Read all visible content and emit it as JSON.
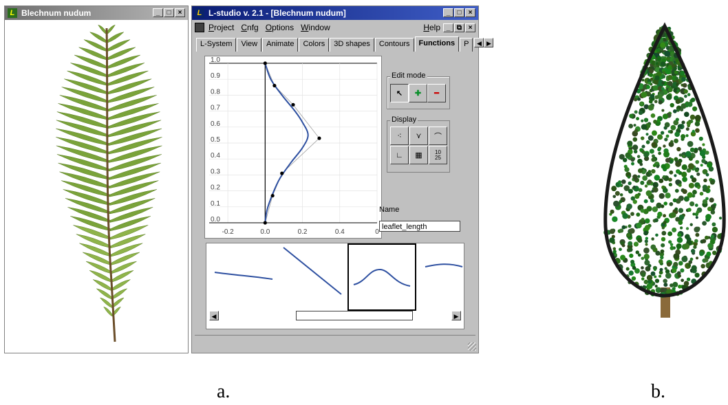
{
  "left_window": {
    "title": "Blechnum nudum",
    "icon": "L",
    "buttons": [
      "_",
      "□",
      "×"
    ]
  },
  "main_window": {
    "title": "L-studio v. 2.1 - [Blechnum nudum]",
    "icon": "L",
    "buttons": [
      "_",
      "□",
      "×"
    ],
    "menu": [
      "Project",
      "Cnfg",
      "Options",
      "Window"
    ],
    "help_label": "Help",
    "mdi_buttons": [
      "_",
      "⧉",
      "×"
    ],
    "tabs": [
      "L-System",
      "View",
      "Animate",
      "Colors",
      "3D shapes",
      "Contours",
      "Functions",
      "P"
    ],
    "active_tab": "Functions",
    "edit_mode_label": "Edit mode",
    "display_label": "Display",
    "name_label": "Name",
    "name_value": "leaflet_length"
  },
  "chart_data": {
    "type": "line",
    "title": "",
    "xlabel": "",
    "ylabel": "",
    "xlim": [
      -0.3,
      0.6
    ],
    "ylim": [
      0.0,
      1.0
    ],
    "y_ticks": [
      "1.0",
      "0.9",
      "0.8",
      "0.7",
      "0.6",
      "0.5",
      "0.4",
      "0.3",
      "0.2",
      "0.1",
      "0.0"
    ],
    "x_ticks": [
      "-0.2",
      "0.0",
      "0.2",
      "0.4",
      "0"
    ],
    "control_points": [
      {
        "x": 0.0,
        "y": 1.0
      },
      {
        "x": 0.05,
        "y": 0.86
      },
      {
        "x": 0.15,
        "y": 0.74
      },
      {
        "x": 0.29,
        "y": 0.53
      },
      {
        "x": 0.09,
        "y": 0.31
      },
      {
        "x": 0.04,
        "y": 0.17
      },
      {
        "x": 0.0,
        "y": 0.0
      }
    ],
    "curve": [
      {
        "x": 0.0,
        "y": 1.0
      },
      {
        "x": 0.03,
        "y": 0.9
      },
      {
        "x": 0.09,
        "y": 0.8
      },
      {
        "x": 0.16,
        "y": 0.7
      },
      {
        "x": 0.2,
        "y": 0.63
      },
      {
        "x": 0.23,
        "y": 0.55
      },
      {
        "x": 0.2,
        "y": 0.47
      },
      {
        "x": 0.14,
        "y": 0.38
      },
      {
        "x": 0.08,
        "y": 0.28
      },
      {
        "x": 0.04,
        "y": 0.18
      },
      {
        "x": 0.01,
        "y": 0.08
      },
      {
        "x": 0.0,
        "y": 0.0
      }
    ]
  },
  "gallery": {
    "items": [
      "function-1",
      "function-2",
      "function-3",
      "function-4"
    ],
    "selected": 2
  },
  "colors": {
    "curve": "#2d4fa0",
    "title_blue": "#0a246a",
    "fern_green": "#7aa33a",
    "tree_green": "#2f7a2a"
  },
  "captions": {
    "a": "a.",
    "b": "b."
  }
}
